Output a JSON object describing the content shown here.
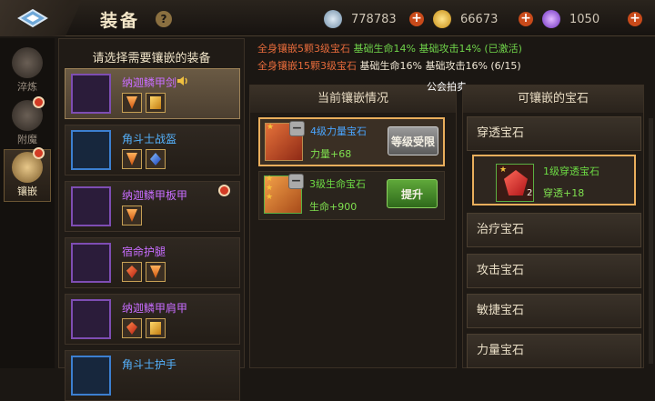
{
  "header": {
    "title": "装备",
    "help": "?",
    "resources": [
      {
        "icon": "silver-coin-icon",
        "value": "778783",
        "color": "#8fb0c8"
      },
      {
        "icon": "gold-coin-icon",
        "value": "66673",
        "color": "#e2b43a"
      },
      {
        "icon": "purple-crystal-icon",
        "value": "1050",
        "color": "#a05ee0"
      }
    ]
  },
  "sidenav": [
    {
      "label": "淬炼",
      "badge": false
    },
    {
      "label": "附魔",
      "badge": true
    },
    {
      "label": "镶嵌",
      "badge": true,
      "active": true
    }
  ],
  "equipment_panel": {
    "header": "请选择需要镶嵌的装备",
    "items": [
      {
        "name": "纳迦鳞甲剑",
        "quality": "purple",
        "gems": [
          "orange",
          "yellow"
        ],
        "selected": true
      },
      {
        "name": "角斗士战盔",
        "quality": "blue",
        "gems": [
          "orange",
          "blue"
        ]
      },
      {
        "name": "纳迦鳞甲板甲",
        "quality": "purple",
        "gems": [
          "orange"
        ],
        "badge": true
      },
      {
        "name": "宿命护腿",
        "quality": "purple",
        "gems": [
          "red",
          "orange"
        ]
      },
      {
        "name": "纳迦鳞甲肩甲",
        "quality": "purple",
        "gems": [
          "red",
          "yellow"
        ]
      },
      {
        "name": "角斗士护手",
        "quality": "blue",
        "gems": []
      }
    ]
  },
  "set_bonus": [
    {
      "cond": "全身镶嵌5颗3级宝石",
      "effect": "基础生命14% 基础攻击14% (已激活)"
    },
    {
      "cond": "全身镶嵌15颗3级宝石",
      "effect": "基础生命16% 基础攻击16% (6/15)"
    }
  ],
  "overlay_text": "公会拍卖",
  "current_panel": {
    "header": "当前镶嵌情况",
    "slots": [
      {
        "name": "4级力量宝石",
        "attr": "力量+68",
        "button": "等级受限",
        "stars": 1
      },
      {
        "name": "3级生命宝石",
        "attr": "生命+900",
        "button": "提升",
        "stars": 3
      }
    ]
  },
  "available_panel": {
    "header": "可镶嵌的宝石",
    "categories": [
      "穿透宝石",
      "治疗宝石",
      "攻击宝石",
      "敏捷宝石",
      "力量宝石"
    ],
    "gem": {
      "name": "1级穿透宝石",
      "attr": "穿透+18",
      "count": "2"
    }
  }
}
